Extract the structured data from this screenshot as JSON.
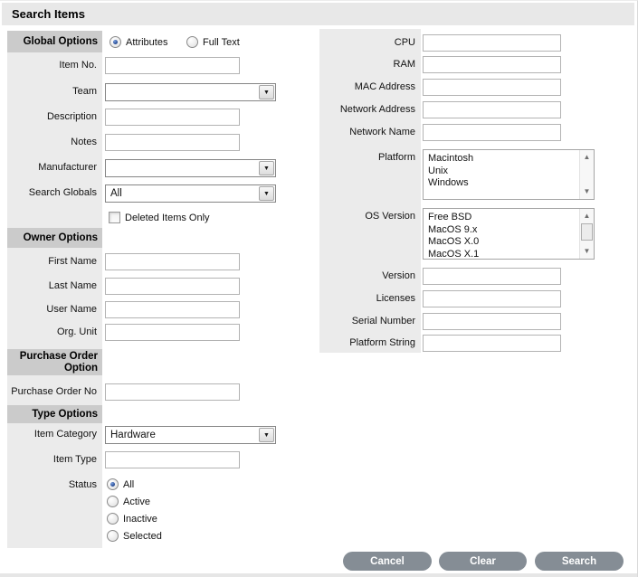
{
  "title": "Search Items",
  "global": {
    "section": "Global Options",
    "attributes": "Attributes",
    "full_text": "Full Text",
    "attributes_selected": "Attributes",
    "item_no": "Item No.",
    "team": "Team",
    "description": "Description",
    "notes": "Notes",
    "manufacturer": "Manufacturer",
    "search_globals": "Search Globals",
    "search_globals_value": "All",
    "deleted_only": "Deleted Items Only",
    "deleted_only_checked": false
  },
  "owner": {
    "section": "Owner Options",
    "first_name": "First Name",
    "last_name": "Last Name",
    "user_name": "User Name",
    "org_unit": "Org. Unit"
  },
  "purchase": {
    "section_line1": "Purchase Order",
    "section_line2": "Option",
    "po_no": "Purchase Order No"
  },
  "type": {
    "section": "Type Options",
    "item_category": "Item Category",
    "item_category_value": "Hardware",
    "item_type": "Item Type",
    "status": "Status",
    "status_options": [
      "All",
      "Active",
      "Inactive",
      "Selected"
    ],
    "status_selected": "All"
  },
  "hardware": {
    "cpu": "CPU",
    "ram": "RAM",
    "mac_address": "MAC Address",
    "network_address": "Network Address",
    "network_name": "Network Name",
    "platform": "Platform",
    "platform_options": [
      "Macintosh",
      "Unix",
      "Windows"
    ],
    "os_version": "OS Version",
    "os_version_options": [
      "Free BSD",
      "MacOS 9.x",
      "MacOS X.0",
      "MacOS X.1"
    ],
    "version": "Version",
    "licenses": "Licenses",
    "serial_number": "Serial Number",
    "platform_string": "Platform String"
  },
  "buttons": {
    "cancel": "Cancel",
    "clear": "Clear",
    "search": "Search"
  },
  "icons": {
    "dropdown_arrow": "▼",
    "scroll_up": "▲",
    "scroll_down": "▼"
  },
  "colors": {
    "titlebar_bg": "#e8e8e8",
    "section_band_bg": "#cbcbcb",
    "label_column_bg": "#ebebeb",
    "button_bg": "#858d95",
    "radio_selected_dot": "#163a85"
  }
}
